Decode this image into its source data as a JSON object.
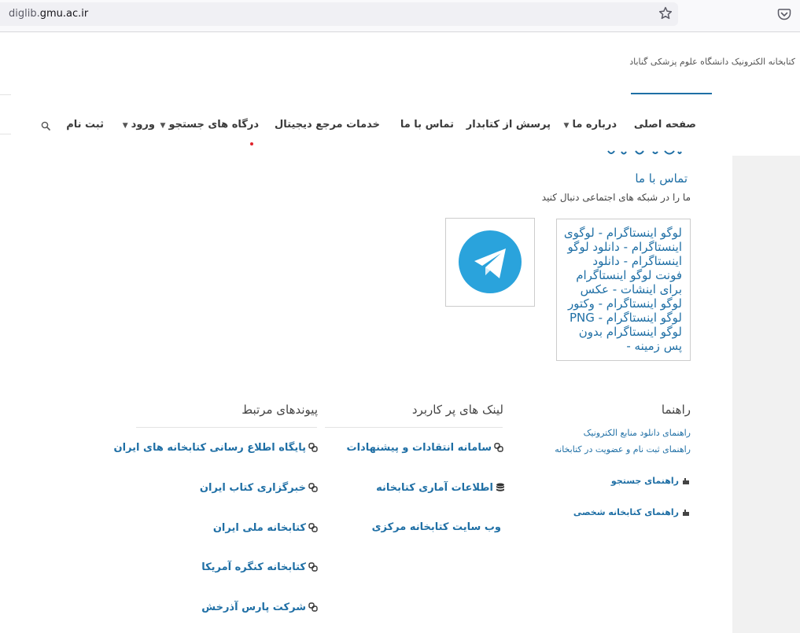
{
  "browser": {
    "url_prefix": "diglib.",
    "url_host": "gmu.ac.ir"
  },
  "site": {
    "name": "کتابخانه الکترونیک دانشگاه علوم پزشکی گناباد"
  },
  "nav": {
    "items": [
      {
        "label": "صفحه اصلی",
        "dropdown": false
      },
      {
        "label": "درباره ما",
        "dropdown": true
      },
      {
        "label": "پرسش از کتابدار",
        "dropdown": false
      },
      {
        "label": "تماس با ما",
        "dropdown": false
      },
      {
        "label": "خدمات مرجع دیجیتال",
        "dropdown": false
      },
      {
        "label": "درگاه های جستجو",
        "dropdown": true
      },
      {
        "label": "ورود",
        "dropdown": true
      },
      {
        "label": "ثبت نام",
        "dropdown": false
      }
    ]
  },
  "content": {
    "contact_title": "تماس با ما",
    "follow_text": "ما را در شبکه های اجتماعی دنبال کنید",
    "instagram_alt": "لوگو اینستاگرام - لوگوی اینستاگرام - دانلود لوگو اینستاگرام - دانلود فونت لوگو اینستاگرام برای اینشات - عکس لوگو اینستاگرام - وکتور لوگو اینستاگرام - PNG لوگو اینستاگرام بدون پس زمینه -"
  },
  "footer": {
    "guide": {
      "title": "راهنما",
      "links": [
        "راهنمای دانلود منابع الکترونیک",
        "راهنمای ثبت نام و عضویت در کتابخانه",
        "راهنمای جستجو",
        "راهنمای کتابخانه شخصی"
      ]
    },
    "useful": {
      "title": "لینک های پر کاربرد",
      "links": [
        "سامانه انتقادات و پیشنهادات",
        "اطلاعات آماری کتابخانه",
        "وب سایت کتابخانه مرکزی"
      ]
    },
    "related": {
      "title": "پیوندهای مرتبط",
      "links": [
        "پایگاه اطلاع رسانی کتابخانه های ایران",
        "خبرگزاری کتاب ایران",
        "کتابخانه ملی ایران",
        "کتابخانه کنگره آمریکا",
        "شرکت پارس آذرخش"
      ]
    }
  },
  "colors": {
    "link": "#1f6fa5",
    "telegram": "#2aa3dc",
    "accent_dot": "#e0232c"
  }
}
